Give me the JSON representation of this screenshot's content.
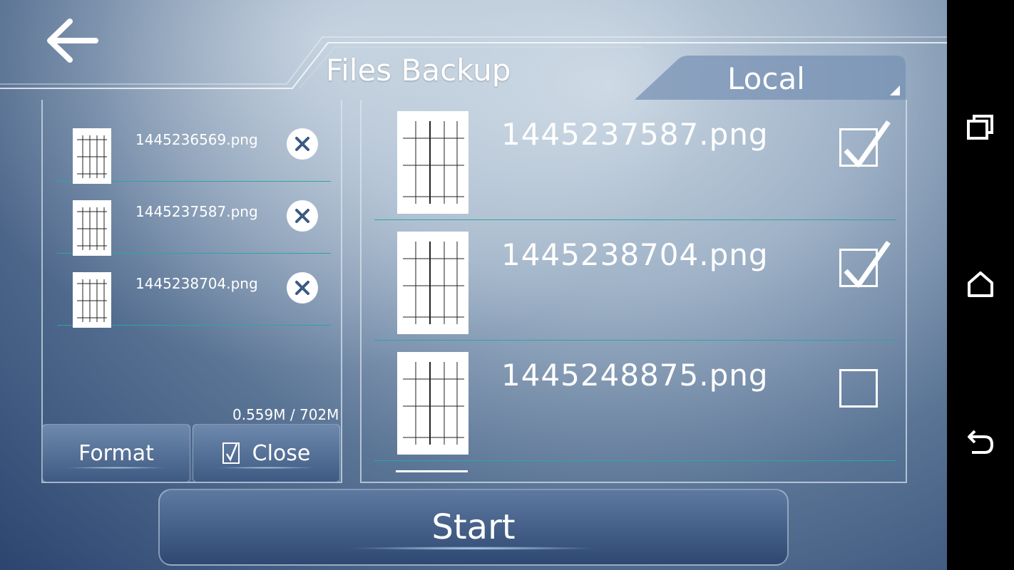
{
  "header": {
    "title": "Files Backup",
    "tab_label": "Local"
  },
  "left_list": {
    "items": [
      {
        "name": "1445236569.png"
      },
      {
        "name": "1445237587.png"
      },
      {
        "name": "1445238704.png"
      }
    ],
    "usage": "0.559M / 702M"
  },
  "buttons": {
    "format": "Format",
    "close": "Close",
    "start": "Start"
  },
  "right_list": {
    "items": [
      {
        "name": "1445237587.png",
        "checked": true
      },
      {
        "name": "1445238704.png",
        "checked": true
      },
      {
        "name": "1445248875.png",
        "checked": false
      }
    ]
  },
  "icons": {
    "back": "arrow-left-icon",
    "remove": "close-circle-icon",
    "recents": "recent-apps-icon",
    "home": "home-icon",
    "nav_back": "undo-back-icon"
  },
  "colors": {
    "divider": "#2aa6a6",
    "navbar": "#000000"
  }
}
